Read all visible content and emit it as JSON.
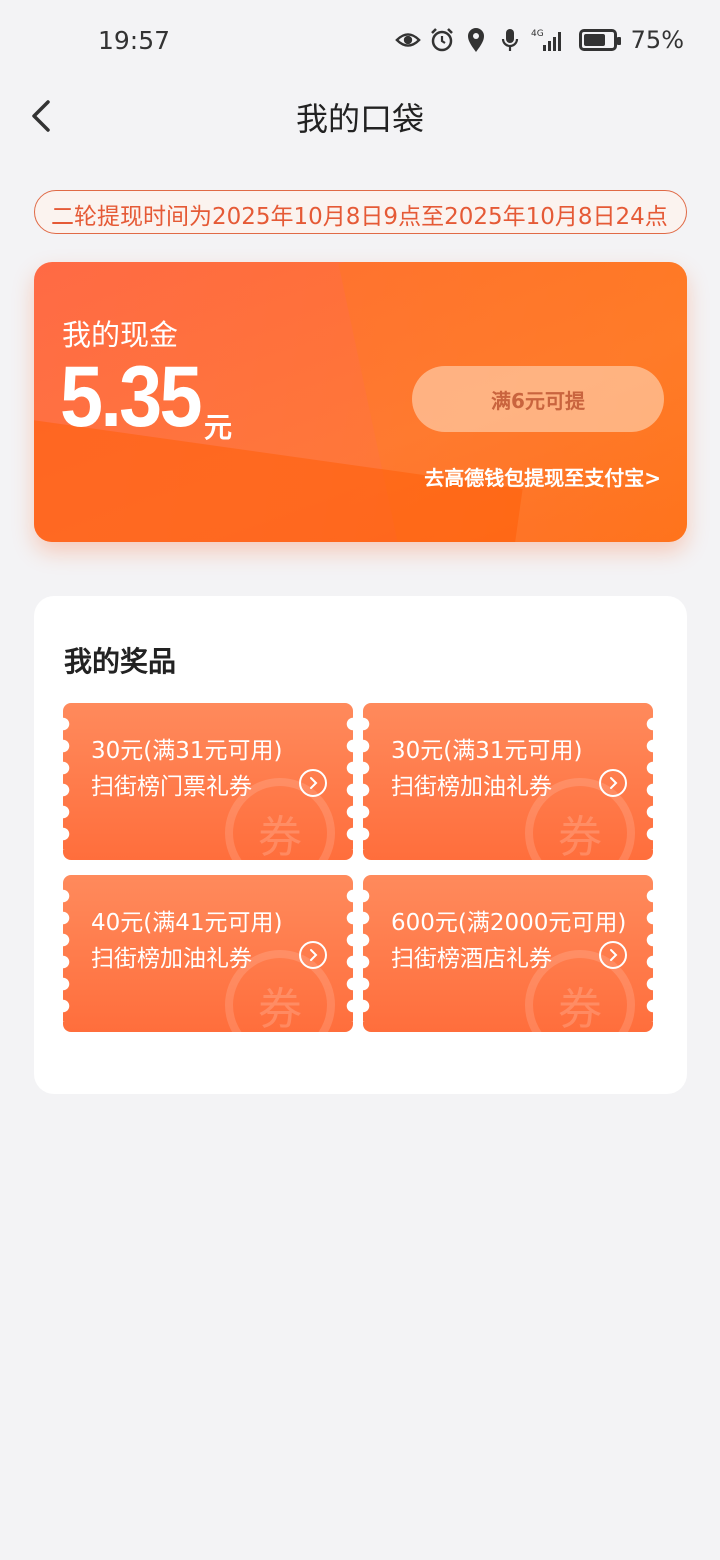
{
  "status_bar": {
    "time": "19:57",
    "network": "4G",
    "battery_percent": "75%",
    "battery_level": 0.75,
    "icons": [
      "eye-icon",
      "alarm-icon",
      "location-icon",
      "mic-icon",
      "signal-icon",
      "battery-icon"
    ]
  },
  "header": {
    "title": "我的口袋",
    "back_icon": "chevron-left-icon"
  },
  "notice": {
    "text": "二轮提现时间为2025年10月8日9点至2025年10月8日24点"
  },
  "cash": {
    "label": "我的现金",
    "amount": "5.35",
    "unit": "元",
    "withdraw_button": "满6元可提",
    "alipay_link": "去高德钱包提现至支付宝>"
  },
  "prizes": {
    "title": "我的奖品",
    "coupons": [
      {
        "amount": "30元(满31元可用)",
        "name": "扫街榜门票礼券",
        "stamp": "券"
      },
      {
        "amount": "30元(满31元可用)",
        "name": "扫街榜加油礼券",
        "stamp": "券"
      },
      {
        "amount": "40元(满41元可用)",
        "name": "扫街榜加油礼券",
        "stamp": "券"
      },
      {
        "amount": "600元(满2000元可用)",
        "name": "扫街榜酒店礼券",
        "stamp": "券"
      }
    ]
  },
  "colors": {
    "accent": "#ff6b35",
    "notice_text": "#e55a36",
    "background": "#f3f3f5"
  }
}
